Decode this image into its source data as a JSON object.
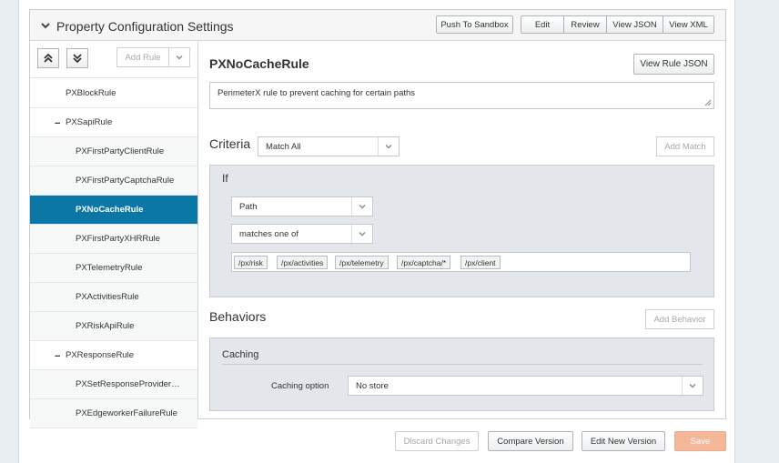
{
  "header": {
    "title": "Property Configuration Settings",
    "buttons": {
      "push_to_sandbox": "Push To Sandbox",
      "edit": "Edit",
      "review": "Review",
      "view_json": "View JSON",
      "view_xml": "View XML"
    }
  },
  "sidebar": {
    "add_rule_placeholder": "Add Rule",
    "rules": [
      {
        "label": "PXBlockRule",
        "level": 1,
        "selected": false
      },
      {
        "label": "PXSapiRule",
        "level": 1,
        "collapsible": true,
        "selected": false
      },
      {
        "label": "PXFirstPartyClientRule",
        "level": 2,
        "selected": false
      },
      {
        "label": "PXFirstPartyCaptchaRule",
        "level": 2,
        "selected": false
      },
      {
        "label": "PXNoCacheRule",
        "level": 2,
        "selected": true
      },
      {
        "label": "PXFirstPartyXHRRule",
        "level": 2,
        "selected": false
      },
      {
        "label": "PXTelemetryRule",
        "level": 2,
        "selected": false
      },
      {
        "label": "PXActivitiesRule",
        "level": 2,
        "selected": false
      },
      {
        "label": "PXRiskApiRule",
        "level": 2,
        "selected": false
      },
      {
        "label": "PXResponseRule",
        "level": 1,
        "collapsible": true,
        "selected": false
      },
      {
        "label": "PXSetResponseProvider…",
        "level": 2,
        "selected": false
      },
      {
        "label": "PXEdgeworkerFailureRule",
        "level": 2,
        "selected": false
      }
    ]
  },
  "main": {
    "rule_name": "PXNoCacheRule",
    "view_rule_json": "View Rule JSON",
    "description": "PerimeterX rule to prevent caching for certain paths",
    "criteria": {
      "label": "Criteria",
      "match_mode": "Match All",
      "add_match": "Add Match",
      "if_label": "If",
      "field": "Path",
      "operator": "matches one of",
      "values": [
        "/px/risk",
        "/px/activities",
        "/px/telemetry",
        "/px/captcha/*",
        "/px/client"
      ]
    },
    "behaviors": {
      "label": "Behaviors",
      "add_behavior": "Add Behavior",
      "behavior_name": "Caching",
      "option_label": "Caching option",
      "option_value": "No store"
    }
  },
  "footer": {
    "discard": "Discard Changes",
    "compare": "Compare Version",
    "edit_new": "Edit New Version",
    "save": "Save"
  }
}
